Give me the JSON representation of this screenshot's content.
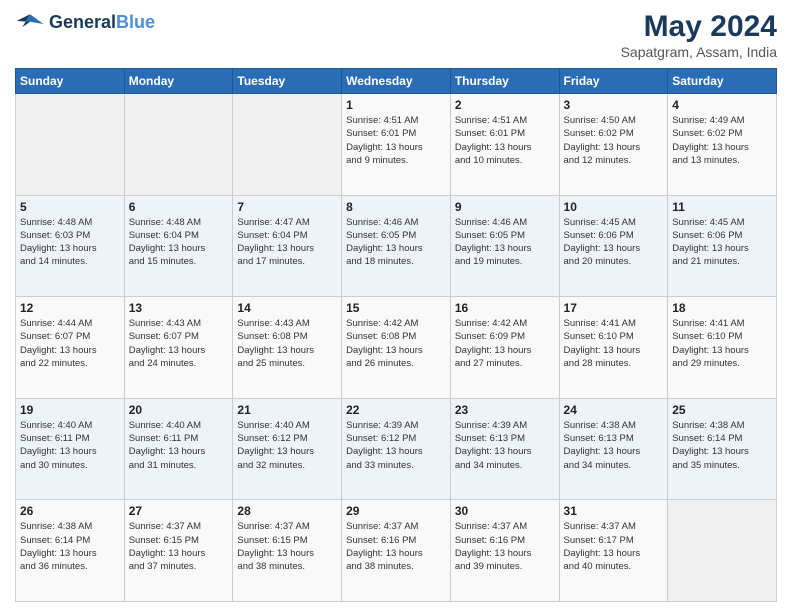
{
  "header": {
    "logo_line1": "General",
    "logo_line2": "Blue",
    "title": "May 2024",
    "subtitle": "Sapatgram, Assam, India"
  },
  "weekdays": [
    "Sunday",
    "Monday",
    "Tuesday",
    "Wednesday",
    "Thursday",
    "Friday",
    "Saturday"
  ],
  "weeks": [
    [
      {
        "day": "",
        "info": ""
      },
      {
        "day": "",
        "info": ""
      },
      {
        "day": "",
        "info": ""
      },
      {
        "day": "1",
        "info": "Sunrise: 4:51 AM\nSunset: 6:01 PM\nDaylight: 13 hours\nand 9 minutes."
      },
      {
        "day": "2",
        "info": "Sunrise: 4:51 AM\nSunset: 6:01 PM\nDaylight: 13 hours\nand 10 minutes."
      },
      {
        "day": "3",
        "info": "Sunrise: 4:50 AM\nSunset: 6:02 PM\nDaylight: 13 hours\nand 12 minutes."
      },
      {
        "day": "4",
        "info": "Sunrise: 4:49 AM\nSunset: 6:02 PM\nDaylight: 13 hours\nand 13 minutes."
      }
    ],
    [
      {
        "day": "5",
        "info": "Sunrise: 4:48 AM\nSunset: 6:03 PM\nDaylight: 13 hours\nand 14 minutes."
      },
      {
        "day": "6",
        "info": "Sunrise: 4:48 AM\nSunset: 6:04 PM\nDaylight: 13 hours\nand 15 minutes."
      },
      {
        "day": "7",
        "info": "Sunrise: 4:47 AM\nSunset: 6:04 PM\nDaylight: 13 hours\nand 17 minutes."
      },
      {
        "day": "8",
        "info": "Sunrise: 4:46 AM\nSunset: 6:05 PM\nDaylight: 13 hours\nand 18 minutes."
      },
      {
        "day": "9",
        "info": "Sunrise: 4:46 AM\nSunset: 6:05 PM\nDaylight: 13 hours\nand 19 minutes."
      },
      {
        "day": "10",
        "info": "Sunrise: 4:45 AM\nSunset: 6:06 PM\nDaylight: 13 hours\nand 20 minutes."
      },
      {
        "day": "11",
        "info": "Sunrise: 4:45 AM\nSunset: 6:06 PM\nDaylight: 13 hours\nand 21 minutes."
      }
    ],
    [
      {
        "day": "12",
        "info": "Sunrise: 4:44 AM\nSunset: 6:07 PM\nDaylight: 13 hours\nand 22 minutes."
      },
      {
        "day": "13",
        "info": "Sunrise: 4:43 AM\nSunset: 6:07 PM\nDaylight: 13 hours\nand 24 minutes."
      },
      {
        "day": "14",
        "info": "Sunrise: 4:43 AM\nSunset: 6:08 PM\nDaylight: 13 hours\nand 25 minutes."
      },
      {
        "day": "15",
        "info": "Sunrise: 4:42 AM\nSunset: 6:08 PM\nDaylight: 13 hours\nand 26 minutes."
      },
      {
        "day": "16",
        "info": "Sunrise: 4:42 AM\nSunset: 6:09 PM\nDaylight: 13 hours\nand 27 minutes."
      },
      {
        "day": "17",
        "info": "Sunrise: 4:41 AM\nSunset: 6:10 PM\nDaylight: 13 hours\nand 28 minutes."
      },
      {
        "day": "18",
        "info": "Sunrise: 4:41 AM\nSunset: 6:10 PM\nDaylight: 13 hours\nand 29 minutes."
      }
    ],
    [
      {
        "day": "19",
        "info": "Sunrise: 4:40 AM\nSunset: 6:11 PM\nDaylight: 13 hours\nand 30 minutes."
      },
      {
        "day": "20",
        "info": "Sunrise: 4:40 AM\nSunset: 6:11 PM\nDaylight: 13 hours\nand 31 minutes."
      },
      {
        "day": "21",
        "info": "Sunrise: 4:40 AM\nSunset: 6:12 PM\nDaylight: 13 hours\nand 32 minutes."
      },
      {
        "day": "22",
        "info": "Sunrise: 4:39 AM\nSunset: 6:12 PM\nDaylight: 13 hours\nand 33 minutes."
      },
      {
        "day": "23",
        "info": "Sunrise: 4:39 AM\nSunset: 6:13 PM\nDaylight: 13 hours\nand 34 minutes."
      },
      {
        "day": "24",
        "info": "Sunrise: 4:38 AM\nSunset: 6:13 PM\nDaylight: 13 hours\nand 34 minutes."
      },
      {
        "day": "25",
        "info": "Sunrise: 4:38 AM\nSunset: 6:14 PM\nDaylight: 13 hours\nand 35 minutes."
      }
    ],
    [
      {
        "day": "26",
        "info": "Sunrise: 4:38 AM\nSunset: 6:14 PM\nDaylight: 13 hours\nand 36 minutes."
      },
      {
        "day": "27",
        "info": "Sunrise: 4:37 AM\nSunset: 6:15 PM\nDaylight: 13 hours\nand 37 minutes."
      },
      {
        "day": "28",
        "info": "Sunrise: 4:37 AM\nSunset: 6:15 PM\nDaylight: 13 hours\nand 38 minutes."
      },
      {
        "day": "29",
        "info": "Sunrise: 4:37 AM\nSunset: 6:16 PM\nDaylight: 13 hours\nand 38 minutes."
      },
      {
        "day": "30",
        "info": "Sunrise: 4:37 AM\nSunset: 6:16 PM\nDaylight: 13 hours\nand 39 minutes."
      },
      {
        "day": "31",
        "info": "Sunrise: 4:37 AM\nSunset: 6:17 PM\nDaylight: 13 hours\nand 40 minutes."
      },
      {
        "day": "",
        "info": ""
      }
    ]
  ]
}
